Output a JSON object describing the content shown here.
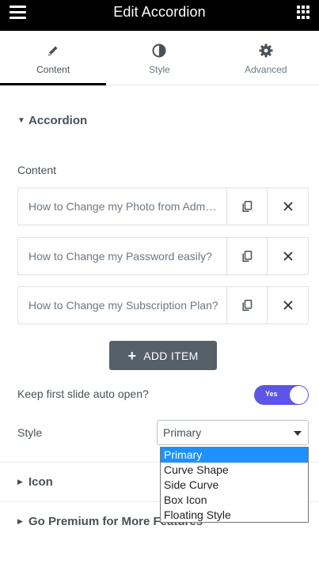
{
  "header": {
    "title": "Edit Accordion"
  },
  "tabs": [
    {
      "label": "Content",
      "icon": "pencil-icon"
    },
    {
      "label": "Style",
      "icon": "half-circle-icon"
    },
    {
      "label": "Advanced",
      "icon": "gear-icon"
    }
  ],
  "sections": {
    "accordion": "Accordion",
    "icon": "Icon",
    "premium": "Go Premium for More Features"
  },
  "content_label": "Content",
  "items": [
    {
      "title": "How to Change my Photo from Admin Dashboard?"
    },
    {
      "title": "How to Change my Password easily?"
    },
    {
      "title": "How to Change my Subscription Plan?"
    }
  ],
  "add_item": "ADD ITEM",
  "auto_open": {
    "label": "Keep first slide auto open?",
    "value": "Yes"
  },
  "style": {
    "label": "Style",
    "selected": "Primary",
    "options": [
      "Primary",
      "Curve Shape",
      "Side Curve",
      "Box Icon",
      "Floating Style"
    ]
  },
  "colors": {
    "switch_on": "#5c55e6",
    "add_button": "#556068",
    "selected_option": "#1e90ff"
  }
}
